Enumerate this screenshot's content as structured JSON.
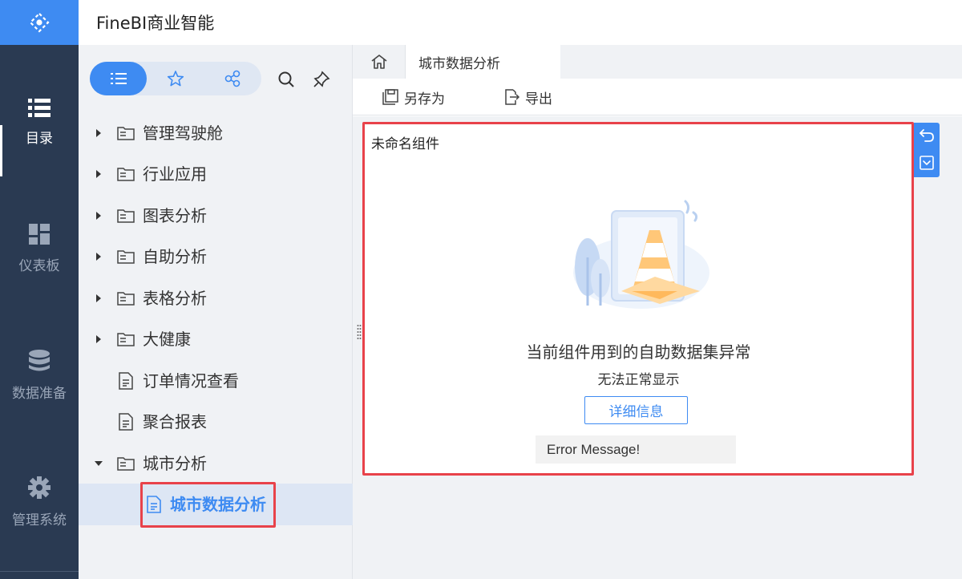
{
  "app": {
    "title": "FineBI商业智能"
  },
  "rail": {
    "items": [
      {
        "label": "目录",
        "icon": "list-icon",
        "active": true
      },
      {
        "label": "仪表板",
        "icon": "dashboard-icon",
        "active": false
      },
      {
        "label": "数据准备",
        "icon": "database-icon",
        "active": false
      },
      {
        "label": "管理系统",
        "icon": "gear-icon",
        "active": false
      }
    ]
  },
  "catalog": {
    "segments": [
      "list-icon",
      "star-icon",
      "share-icon"
    ],
    "tools": [
      "search-icon",
      "pin-icon"
    ],
    "tree": [
      {
        "label": "管理驾驶舱",
        "type": "folder",
        "expanded": false
      },
      {
        "label": "行业应用",
        "type": "folder",
        "expanded": false
      },
      {
        "label": "图表分析",
        "type": "folder",
        "expanded": false
      },
      {
        "label": "自助分析",
        "type": "folder",
        "expanded": false
      },
      {
        "label": "表格分析",
        "type": "folder",
        "expanded": false
      },
      {
        "label": "大健康",
        "type": "folder",
        "expanded": false
      },
      {
        "label": "订单情况查看",
        "type": "report"
      },
      {
        "label": "聚合报表",
        "type": "report"
      },
      {
        "label": "城市分析",
        "type": "folder",
        "expanded": true
      },
      {
        "label": "城市数据分析",
        "type": "report",
        "selected": true
      }
    ]
  },
  "tabs": {
    "active_label": "城市数据分析"
  },
  "toolbar": {
    "save_as_label": "另存为",
    "export_label": "导出"
  },
  "widget": {
    "title": "未命名组件",
    "error_main": "当前组件用到的自助数据集异常",
    "error_sub": "无法正常显示",
    "detail_button": "详细信息",
    "error_message": "Error Message!"
  },
  "colors": {
    "accent": "#3e8bf2",
    "rail_bg": "#2a3a52",
    "highlight": "#e8424a"
  }
}
